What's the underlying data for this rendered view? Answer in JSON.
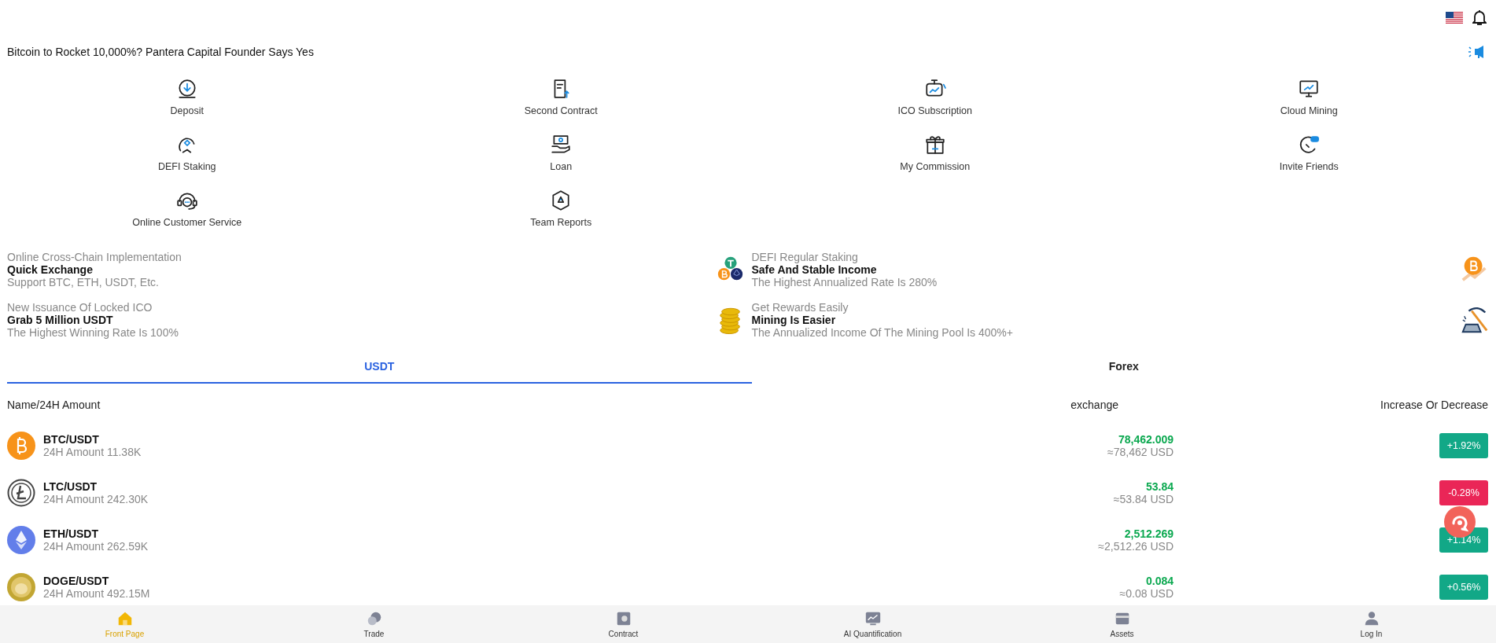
{
  "headline": {
    "text": "Bitcoin to Rocket 10,000%? Pantera Capital Founder Says Yes"
  },
  "menu": [
    {
      "label": "Deposit"
    },
    {
      "label": "Second Contract"
    },
    {
      "label": "ICO Subscription"
    },
    {
      "label": "Cloud Mining"
    },
    {
      "label": "DEFI Staking"
    },
    {
      "label": "Loan"
    },
    {
      "label": "My Commission"
    },
    {
      "label": "Invite Friends"
    },
    {
      "label": "Online Customer Service"
    },
    {
      "label": "Team Reports"
    }
  ],
  "promos": [
    {
      "kicker": "Online Cross-Chain Implementation",
      "title": "Quick Exchange",
      "subtitle": "Support BTC, ETH, USDT, Etc."
    },
    {
      "kicker": "DEFI Regular Staking",
      "title": "Safe And Stable Income",
      "subtitle": "The Highest Annualized Rate Is 280%"
    },
    {
      "kicker": "New Issuance Of Locked ICO",
      "title": "Grab 5 Million USDT",
      "subtitle": "The Highest Winning Rate Is 100%"
    },
    {
      "kicker": "Get Rewards Easily",
      "title": "Mining Is Easier",
      "subtitle": "The Annualized Income Of The Mining Pool Is 400%+"
    }
  ],
  "tabs": [
    {
      "label": "USDT",
      "selected": true
    },
    {
      "label": "Forex",
      "selected": false
    }
  ],
  "table": {
    "columns": [
      "Name/24H Amount",
      "exchange",
      "Increase Or Decrease"
    ],
    "rows": [
      {
        "pair": "BTC/USDT",
        "amount": "24H Amount 11.38K",
        "price": "78,462.009",
        "usd": "≈78,462 USD",
        "change": "+1.92%",
        "color": "#12a887"
      },
      {
        "pair": "LTC/USDT",
        "amount": "24H Amount 242.30K",
        "price": "53.84",
        "usd": "≈53.84 USD",
        "change": "-0.28%",
        "color": "#ea2657"
      },
      {
        "pair": "ETH/USDT",
        "amount": "24H Amount 262.59K",
        "price": "2,512.269",
        "usd": "≈2,512.26 USD",
        "change": "+1.14%",
        "color": "#12a887"
      },
      {
        "pair": "DOGE/USDT",
        "amount": "24H Amount 492.15M",
        "price": "0.084",
        "usd": "≈0.08 USD",
        "change": "+0.56%",
        "color": "#12a887"
      }
    ]
  },
  "bottom_nav": [
    {
      "label": "Front Page",
      "selected": true
    },
    {
      "label": "Trade",
      "selected": false
    },
    {
      "label": "Contract",
      "selected": false
    },
    {
      "label": "AI Quantification",
      "selected": false
    },
    {
      "label": "Assets",
      "selected": false
    },
    {
      "label": "Log In",
      "selected": false
    }
  ]
}
